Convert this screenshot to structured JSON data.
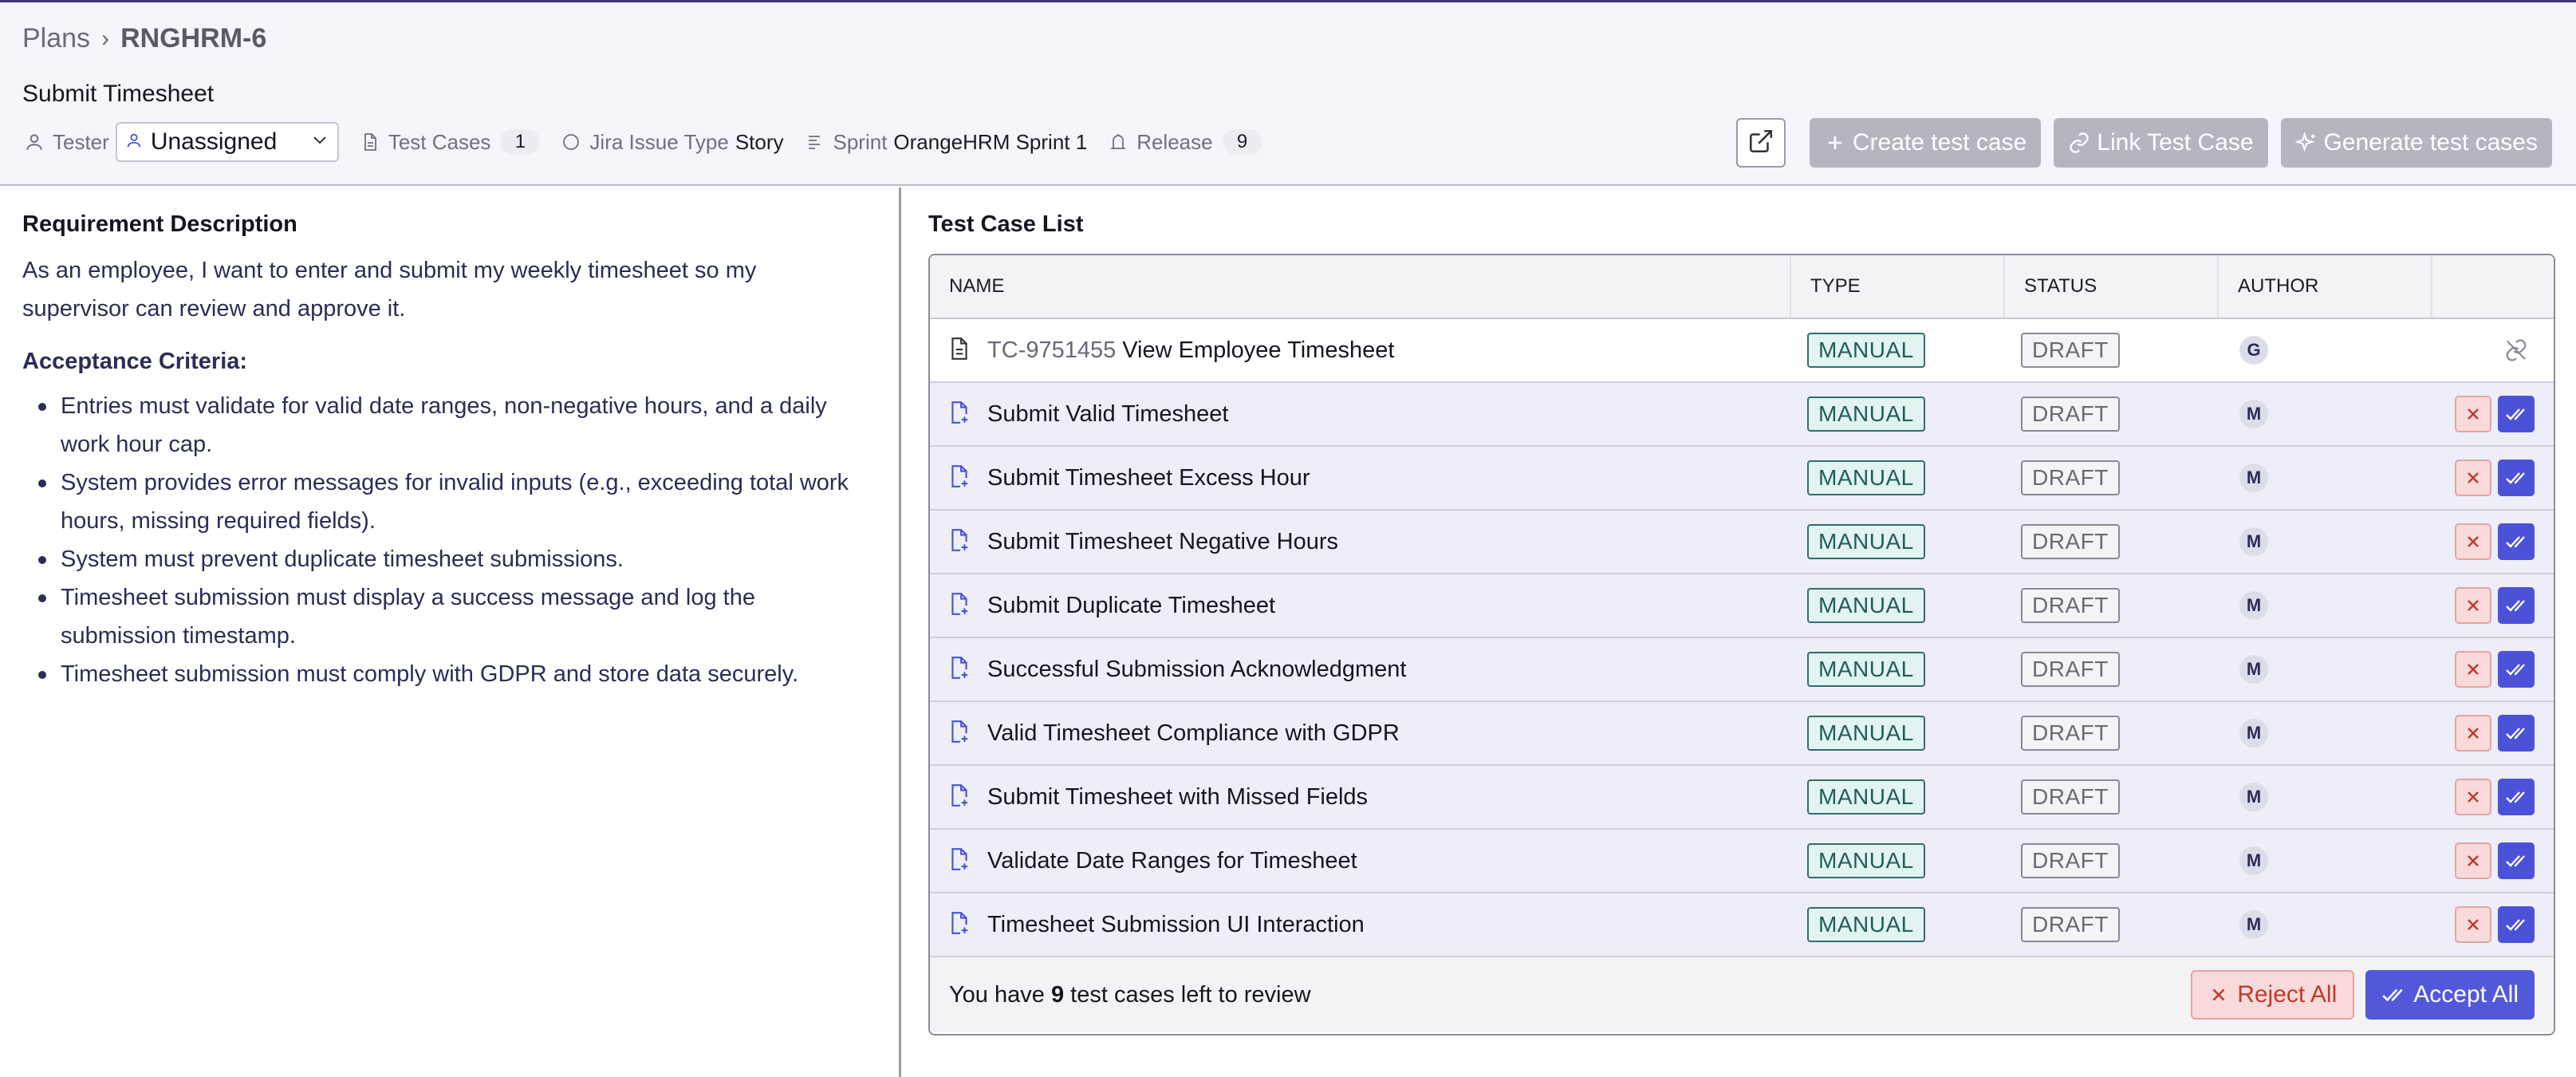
{
  "header": {
    "breadcrumb": {
      "root": "Plans",
      "current": "RNGHRM-6"
    },
    "title": "Submit Timesheet",
    "meta": {
      "tester_label": "Tester",
      "tester_value": "Unassigned",
      "test_cases_label": "Test Cases",
      "test_cases_count": "1",
      "jira_label": "Jira Issue Type",
      "jira_value": "Story",
      "sprint_label": "Sprint",
      "sprint_value": "OrangeHRM Sprint 1",
      "release_label": "Release",
      "release_count": "9"
    },
    "actions": {
      "create": "Create test case",
      "link": "Link Test Case",
      "generate": "Generate test cases"
    }
  },
  "requirement": {
    "heading": "Requirement Description",
    "description": "As an employee, I want to enter and submit my weekly timesheet so my supervisor can review and approve it.",
    "acceptance_heading": "Acceptance Criteria:",
    "criteria": [
      "Entries must validate for valid date ranges, non-negative hours, and a daily work hour cap.",
      "System provides error messages for invalid inputs (e.g., exceeding total work hours, missing required fields).",
      "System must prevent duplicate timesheet submissions.",
      "Timesheet submission must display a success message and log the submission timestamp.",
      "Timesheet submission must comply with GDPR and store data securely."
    ]
  },
  "test_cases": {
    "heading": "Test Case List",
    "columns": {
      "name": "NAME",
      "type": "TYPE",
      "status": "STATUS",
      "author": "AUTHOR"
    },
    "rows": [
      {
        "id": "TC-9751455",
        "name": "View Employee Timesheet",
        "type": "MANUAL",
        "status": "DRAFT",
        "author": "G"
      },
      {
        "id": "",
        "name": "Submit Valid Timesheet",
        "type": "MANUAL",
        "status": "DRAFT",
        "author": "M"
      },
      {
        "id": "",
        "name": "Submit Timesheet Excess Hour",
        "type": "MANUAL",
        "status": "DRAFT",
        "author": "M"
      },
      {
        "id": "",
        "name": "Submit Timesheet Negative Hours",
        "type": "MANUAL",
        "status": "DRAFT",
        "author": "M"
      },
      {
        "id": "",
        "name": "Submit Duplicate Timesheet",
        "type": "MANUAL",
        "status": "DRAFT",
        "author": "M"
      },
      {
        "id": "",
        "name": "Successful Submission Acknowledgment",
        "type": "MANUAL",
        "status": "DRAFT",
        "author": "M"
      },
      {
        "id": "",
        "name": "Valid Timesheet Compliance with GDPR",
        "type": "MANUAL",
        "status": "DRAFT",
        "author": "M"
      },
      {
        "id": "",
        "name": "Submit Timesheet with Missed Fields",
        "type": "MANUAL",
        "status": "DRAFT",
        "author": "M"
      },
      {
        "id": "",
        "name": "Validate Date Ranges for Timesheet",
        "type": "MANUAL",
        "status": "DRAFT",
        "author": "M"
      },
      {
        "id": "",
        "name": "Timesheet Submission UI Interaction",
        "type": "MANUAL",
        "status": "DRAFT",
        "author": "M"
      }
    ],
    "footer": {
      "prefix": "You have",
      "count": "9",
      "suffix": "test cases left to review",
      "reject_all": "Reject All",
      "accept_all": "Accept All"
    }
  }
}
